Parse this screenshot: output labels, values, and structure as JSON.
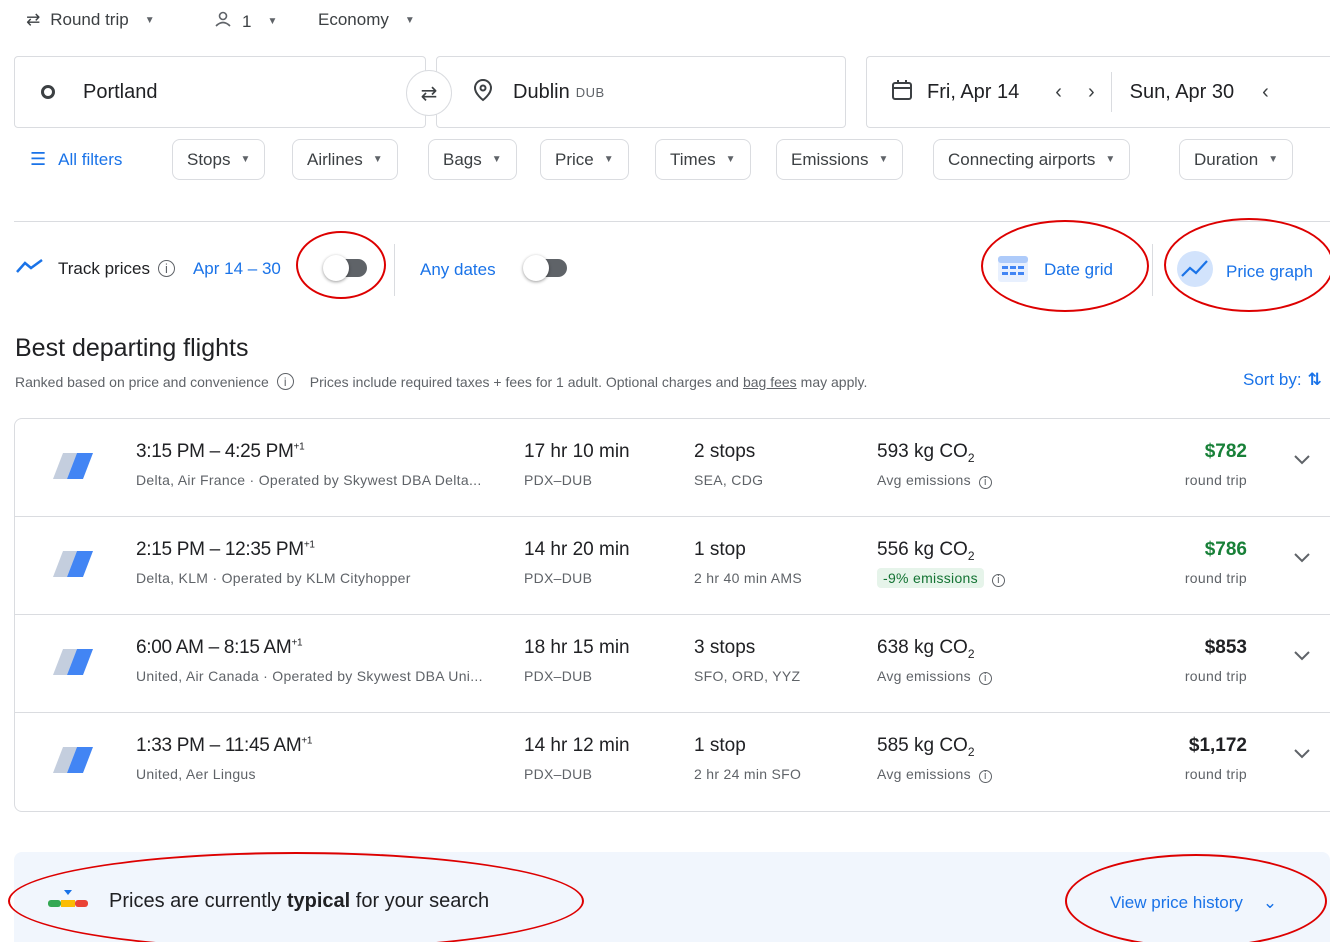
{
  "topbar": {
    "trip_type": "Round trip",
    "passengers": "1",
    "cabin": "Economy"
  },
  "search": {
    "origin": "Portland",
    "destination": "Dublin",
    "destination_code": "DUB",
    "depart_date": "Fri, Apr 14",
    "return_date": "Sun, Apr 30"
  },
  "filters": {
    "all_filters": "All filters",
    "chips": [
      "Stops",
      "Airlines",
      "Bags",
      "Price",
      "Times",
      "Emissions",
      "Connecting airports",
      "Duration"
    ]
  },
  "tracking": {
    "track_label": "Track prices",
    "track_range": "Apr 14 – 30",
    "any_dates": "Any dates",
    "date_grid": "Date grid",
    "price_graph": "Price graph"
  },
  "results": {
    "title": "Best departing flights",
    "subtitle_left": "Ranked based on price and convenience",
    "subtitle_right_pre": "Prices include required taxes + fees for 1 adult. Optional charges and",
    "subtitle_link": "bag fees",
    "subtitle_right_post": "may apply.",
    "sort_label": "Sort by:",
    "flights": [
      {
        "time": "3:15 PM – 4:25 PM",
        "plus": "+1",
        "airline": "Delta, Air France · Operated by Skywest DBA Delta...",
        "duration": "17 hr 10 min",
        "route": "PDX–DUB",
        "stops": "2 stops",
        "stop_info": "SEA, CDG",
        "co2": "593 kg CO",
        "co2_sub": "2",
        "emissions": "Avg emissions",
        "price": "$782",
        "price_type": "round trip",
        "price_color": "#188038"
      },
      {
        "time": "2:15 PM – 12:35 PM",
        "plus": "+1",
        "airline": "Delta, KLM · Operated by KLM Cityhopper",
        "duration": "14 hr 20 min",
        "route": "PDX–DUB",
        "stops": "1 stop",
        "stop_info": "2 hr 40 min AMS",
        "co2": "556 kg CO",
        "co2_sub": "2",
        "emissions": "-9% emissions",
        "price": "$786",
        "price_type": "round trip",
        "price_color": "#188038"
      },
      {
        "time": "6:00 AM – 8:15 AM",
        "plus": "+1",
        "airline": "United, Air Canada · Operated by Skywest DBA Uni...",
        "duration": "18 hr 15 min",
        "route": "PDX–DUB",
        "stops": "3 stops",
        "stop_info": "SFO, ORD, YYZ",
        "co2": "638 kg CO",
        "co2_sub": "2",
        "emissions": "Avg emissions",
        "price": "$853",
        "price_type": "round trip",
        "price_color": "#202124"
      },
      {
        "time": "1:33 PM – 11:45 AM",
        "plus": "+1",
        "airline": "United, Aer Lingus",
        "duration": "14 hr 12 min",
        "route": "PDX–DUB",
        "stops": "1 stop",
        "stop_info": "2 hr 24 min SFO",
        "co2": "585 kg CO",
        "co2_sub": "2",
        "emissions": "Avg emissions",
        "price": "$1,172",
        "price_type": "round trip",
        "price_color": "#202124"
      }
    ]
  },
  "insights": {
    "pre": "Prices are currently",
    "bold": "typical",
    "post": "for your search",
    "history": "View price history"
  },
  "colors": {
    "accent": "#1a73e8",
    "green": "#188038",
    "annotation": "#dd0000"
  }
}
